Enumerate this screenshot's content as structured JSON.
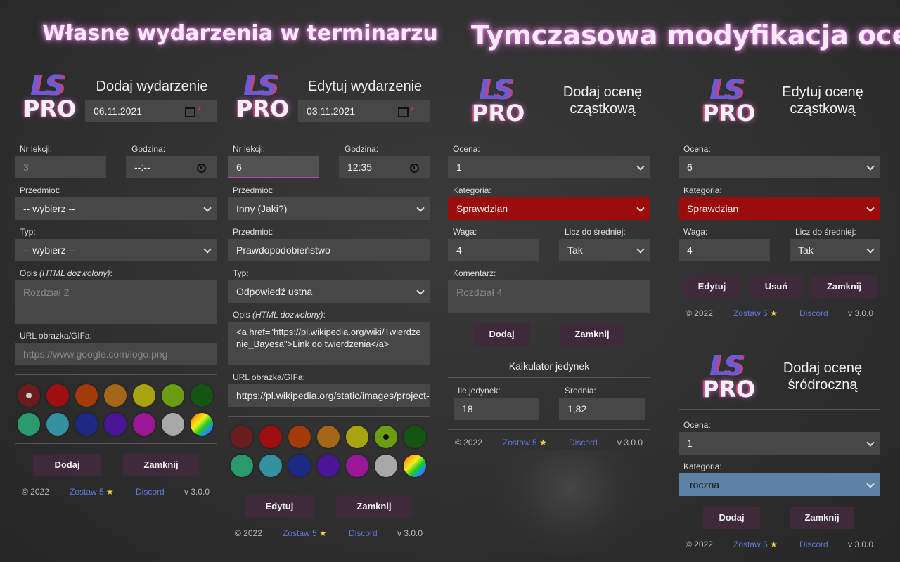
{
  "headings": {
    "left": "Własne wydarzenia w terminarzu",
    "right": "Tymczasowa modyfikacja ocen"
  },
  "logo": {
    "ls": "LS",
    "pro": "PRO"
  },
  "footer": {
    "copyright": "© 2022",
    "rate": "Zostaw 5",
    "discord": "Discord",
    "version": "v 3.0.0"
  },
  "panel_add_event": {
    "title": "Dodaj wydarzenie",
    "date": "06.11.2021",
    "nr_label": "Nr lekcji:",
    "nr_placeholder": "3",
    "time_label": "Godzina:",
    "time_value": "--:--",
    "subject_label": "Przedmiot:",
    "subject_value": "-- wybierz --",
    "type_label": "Typ:",
    "type_value": "-- wybierz --",
    "desc_label": "Opis",
    "desc_note": "(HTML dozwolony)",
    "desc_colon": ":",
    "desc_placeholder": "Rozdział 2",
    "url_label": "URL obrazka/GIFa:",
    "url_placeholder": "https://www.google.com/logo.png",
    "add": "Dodaj",
    "close": "Zamknij"
  },
  "panel_edit_event": {
    "title": "Edytuj wydarzenie",
    "date": "03.11.2021",
    "nr_label": "Nr lekcji:",
    "nr_value": "6",
    "time_label": "Godzina:",
    "time_value": "12:35",
    "subject_label": "Przedmiot:",
    "subject_value": "Inny (Jaki?)",
    "subject2_label": "Przedmiot:",
    "subject2_value": "Prawdopodobieństwo",
    "type_label": "Typ:",
    "type_value": "Odpowiedź ustna",
    "desc_label": "Opis",
    "desc_note": "(HTML dozwolony)",
    "desc_colon": ":",
    "desc_value": "<a href=\"https://pl.wikipedia.org/wiki/Twierdzenie_Bayesa\">Link do twierdzenia</a>",
    "url_label": "URL obrazka/GIFa:",
    "url_value": "https://pl.wikipedia.org/static/images/project-logos",
    "edit": "Edytuj",
    "close": "Zamknij"
  },
  "panel_add_grade": {
    "title": "Dodaj ocenę cząstkową",
    "grade_label": "Ocena:",
    "grade_value": "1",
    "cat_label": "Kategoria:",
    "cat_value": "Sprawdzian",
    "weight_label": "Waga:",
    "weight_value": "4",
    "avg_label": "Licz do średniej:",
    "avg_value": "Tak",
    "comment_label": "Komentarz:",
    "comment_placeholder": "Rozdział 4",
    "add": "Dodaj",
    "close": "Zamknij",
    "calc_title": "Kalkulator jedynek",
    "ones_label": "Ile jedynek:",
    "ones_value": "18",
    "mean_label": "Średnia:",
    "mean_value": "1,82"
  },
  "panel_edit_grade": {
    "title": "Edytuj ocenę cząstkową",
    "grade_label": "Ocena:",
    "grade_value": "6",
    "cat_label": "Kategoria:",
    "cat_value": "Sprawdzian",
    "weight_label": "Waga:",
    "weight_value": "4",
    "avg_label": "Licz do średniej:",
    "avg_value": "Tak",
    "edit": "Edytuj",
    "delete": "Usuń",
    "close": "Zamknij"
  },
  "panel_add_term": {
    "title": "Dodaj ocenę śródroczną",
    "grade_label": "Ocena:",
    "grade_value": "1",
    "cat_label": "Kategoria:",
    "cat_value": "roczna",
    "add": "Dodaj",
    "close": "Zamknij"
  },
  "colors": [
    "#6b1d1d",
    "#9e0f0f",
    "#a23a0a",
    "#a66618",
    "#a8a410",
    "#6a9e10",
    "#135512",
    "#2a9a6c",
    "#3391a0",
    "#1c2a86",
    "#4a1596",
    "#9a1898",
    "#a8a8a8",
    "rainbow"
  ]
}
